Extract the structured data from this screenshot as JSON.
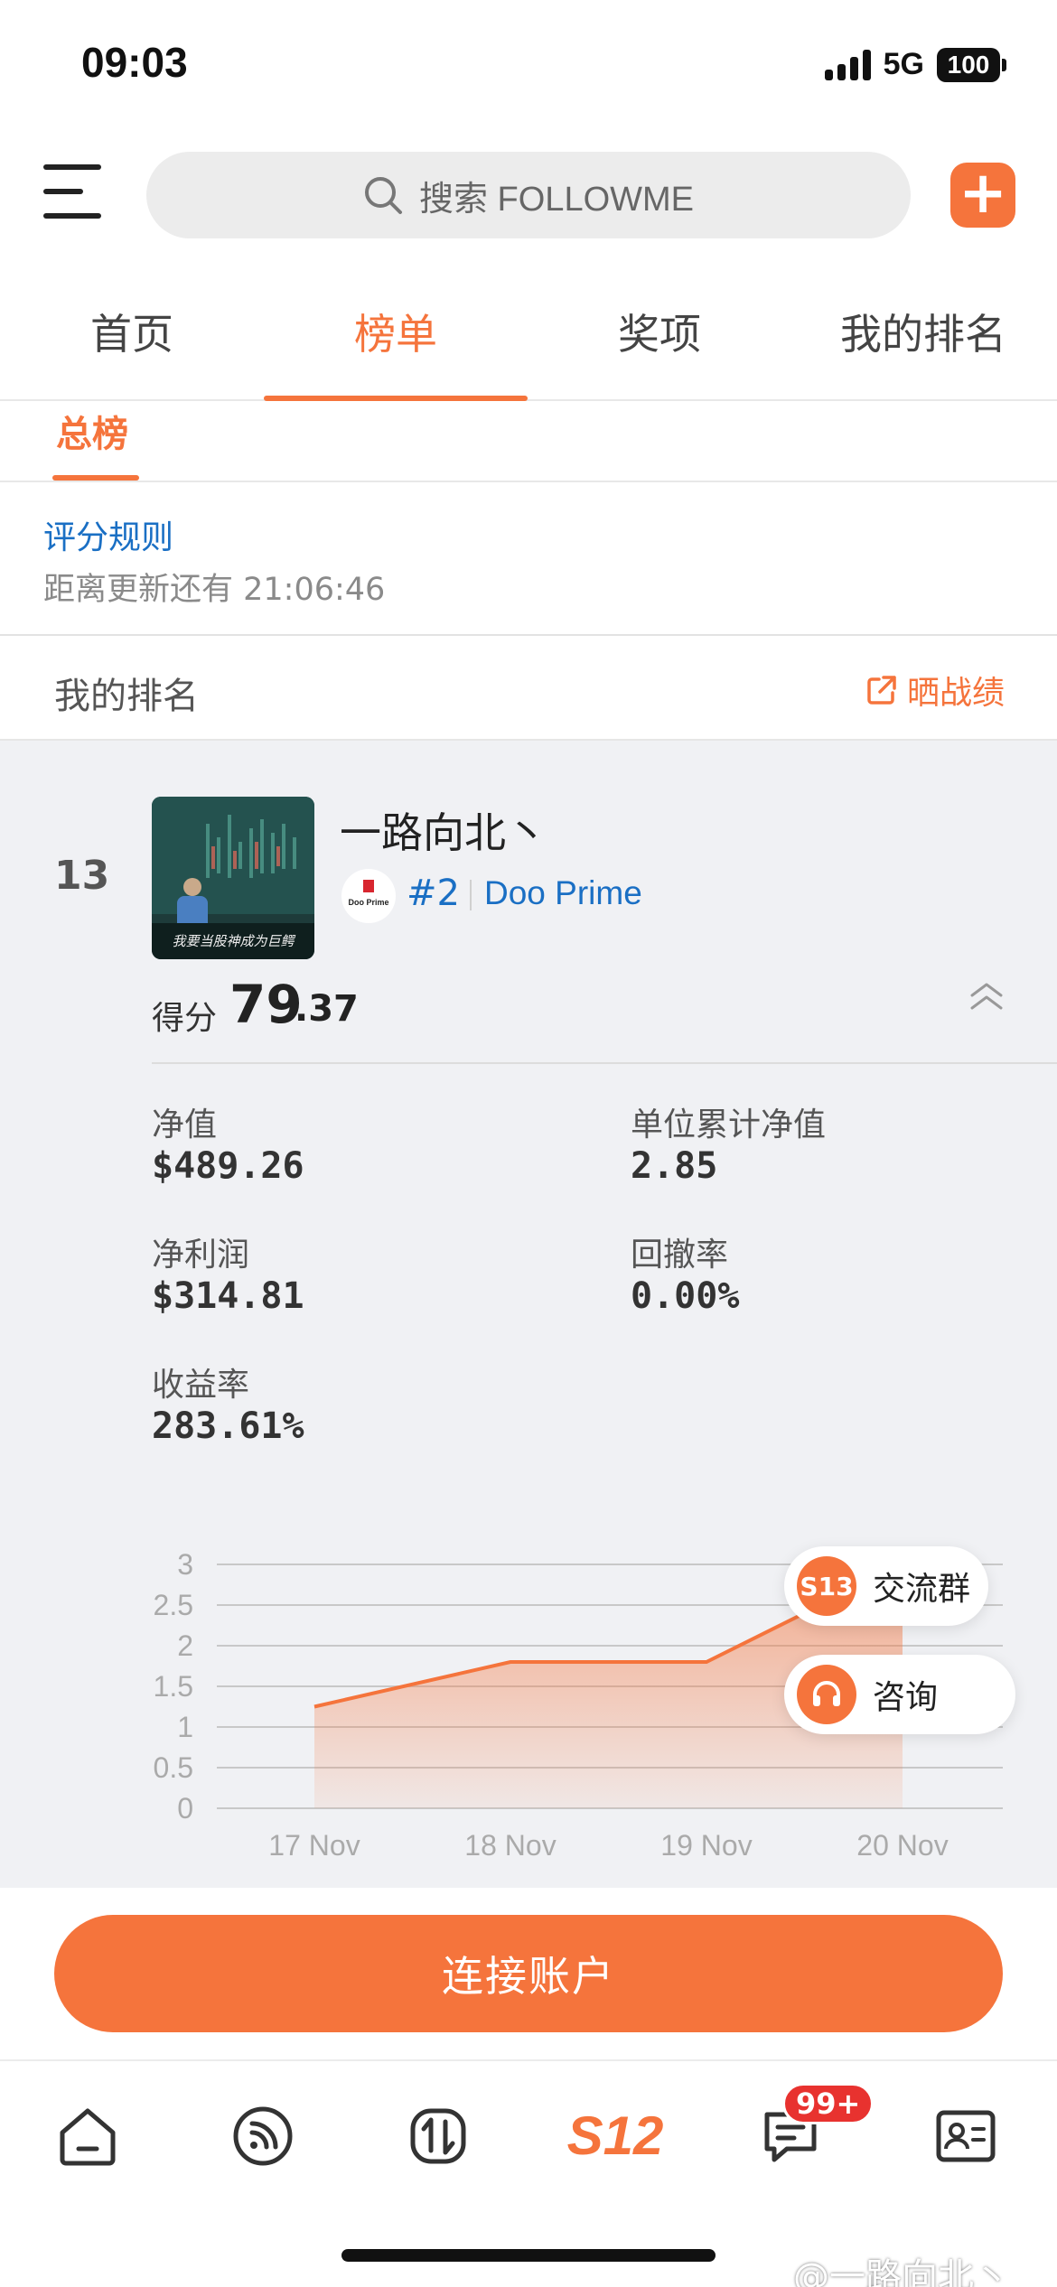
{
  "status_bar": {
    "time": "09:03",
    "network": "5G",
    "battery": "100"
  },
  "search": {
    "placeholder": "搜索 FOLLOWME"
  },
  "tabs": [
    {
      "label": "首页",
      "active": false
    },
    {
      "label": "榜单",
      "active": true
    },
    {
      "label": "奖项",
      "active": false
    },
    {
      "label": "我的排名",
      "active": false
    }
  ],
  "subtab": {
    "label": "总榜"
  },
  "rules": {
    "link": "评分规则",
    "countdown": "距离更新还有 21:06:46"
  },
  "my_rank": {
    "title": "我的排名",
    "share_label": "晒战绩"
  },
  "user": {
    "rank": "13",
    "name": "一路向北丶",
    "avatar_caption": "我要当股神成为巨鳄",
    "broker_rank": "#2",
    "broker_name": "Doo Prime",
    "broker_logo_text": "Doo Prime",
    "score_label": "得分",
    "score_int": "79",
    "score_dec": ".37"
  },
  "stats": {
    "net_value_label": "净值",
    "net_value": "$489.26",
    "unit_nav_label": "单位累计净值",
    "unit_nav": "2.85",
    "net_profit_label": "净利润",
    "net_profit": "$314.81",
    "drawdown_label": "回撤率",
    "drawdown": "0.00%",
    "yield_label": "收益率",
    "yield": "283.61%"
  },
  "chart_data": {
    "type": "area",
    "x": [
      "17 Nov",
      "18 Nov",
      "19 Nov",
      "20 Nov"
    ],
    "y_ticks": [
      "0",
      "0.5",
      "1",
      "1.5",
      "2",
      "2.5",
      "3"
    ],
    "ylim": [
      0,
      3
    ],
    "series": [
      {
        "points": [
          [
            0,
            1.25
          ],
          [
            1,
            1.8
          ],
          [
            2,
            1.8
          ],
          [
            2.5,
            2.4
          ],
          [
            3,
            2.85
          ]
        ]
      }
    ],
    "grid": true,
    "color": "#f5743c"
  },
  "floating": {
    "group_label": "交流群",
    "group_icon_text": "S13",
    "consult_label": "咨询"
  },
  "connect_button": "连接账户",
  "bottom_nav": {
    "items": [
      "home-icon",
      "feed-icon",
      "trade-icon",
      "s12-icon",
      "message-icon",
      "profile-card-icon"
    ],
    "s12_text": "S12",
    "badge": "99+"
  },
  "watermark": "@一路向北丶",
  "colors": {
    "accent": "#f5743c",
    "link": "#1a6fc4",
    "badge": "#e8322f"
  }
}
